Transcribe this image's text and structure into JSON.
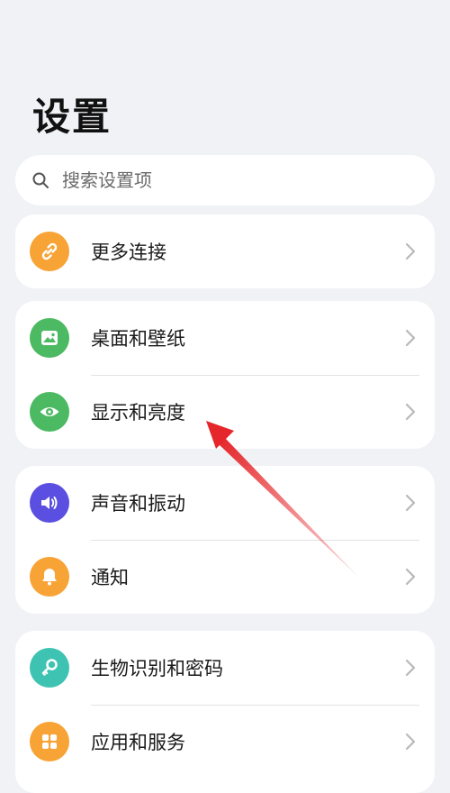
{
  "header": {
    "title": "设置"
  },
  "search": {
    "placeholder": "搜索设置项"
  },
  "colors": {
    "orange": "#f7a335",
    "green": "#4cb963",
    "purple": "#5a4fe0",
    "teal": "#3ec3b2",
    "annotation": "#e5262a"
  },
  "groups": [
    {
      "items": [
        {
          "label": "更多连接",
          "icon": "link-icon"
        }
      ]
    },
    {
      "items": [
        {
          "label": "桌面和壁纸",
          "icon": "image-icon"
        },
        {
          "label": "显示和亮度",
          "icon": "eye-icon"
        }
      ]
    },
    {
      "items": [
        {
          "label": "声音和振动",
          "icon": "speaker-icon"
        },
        {
          "label": "通知",
          "icon": "bell-icon"
        }
      ]
    },
    {
      "items": [
        {
          "label": "生物识别和密码",
          "icon": "key-icon"
        },
        {
          "label": "应用和服务",
          "icon": "apps-grid-icon"
        }
      ]
    }
  ]
}
